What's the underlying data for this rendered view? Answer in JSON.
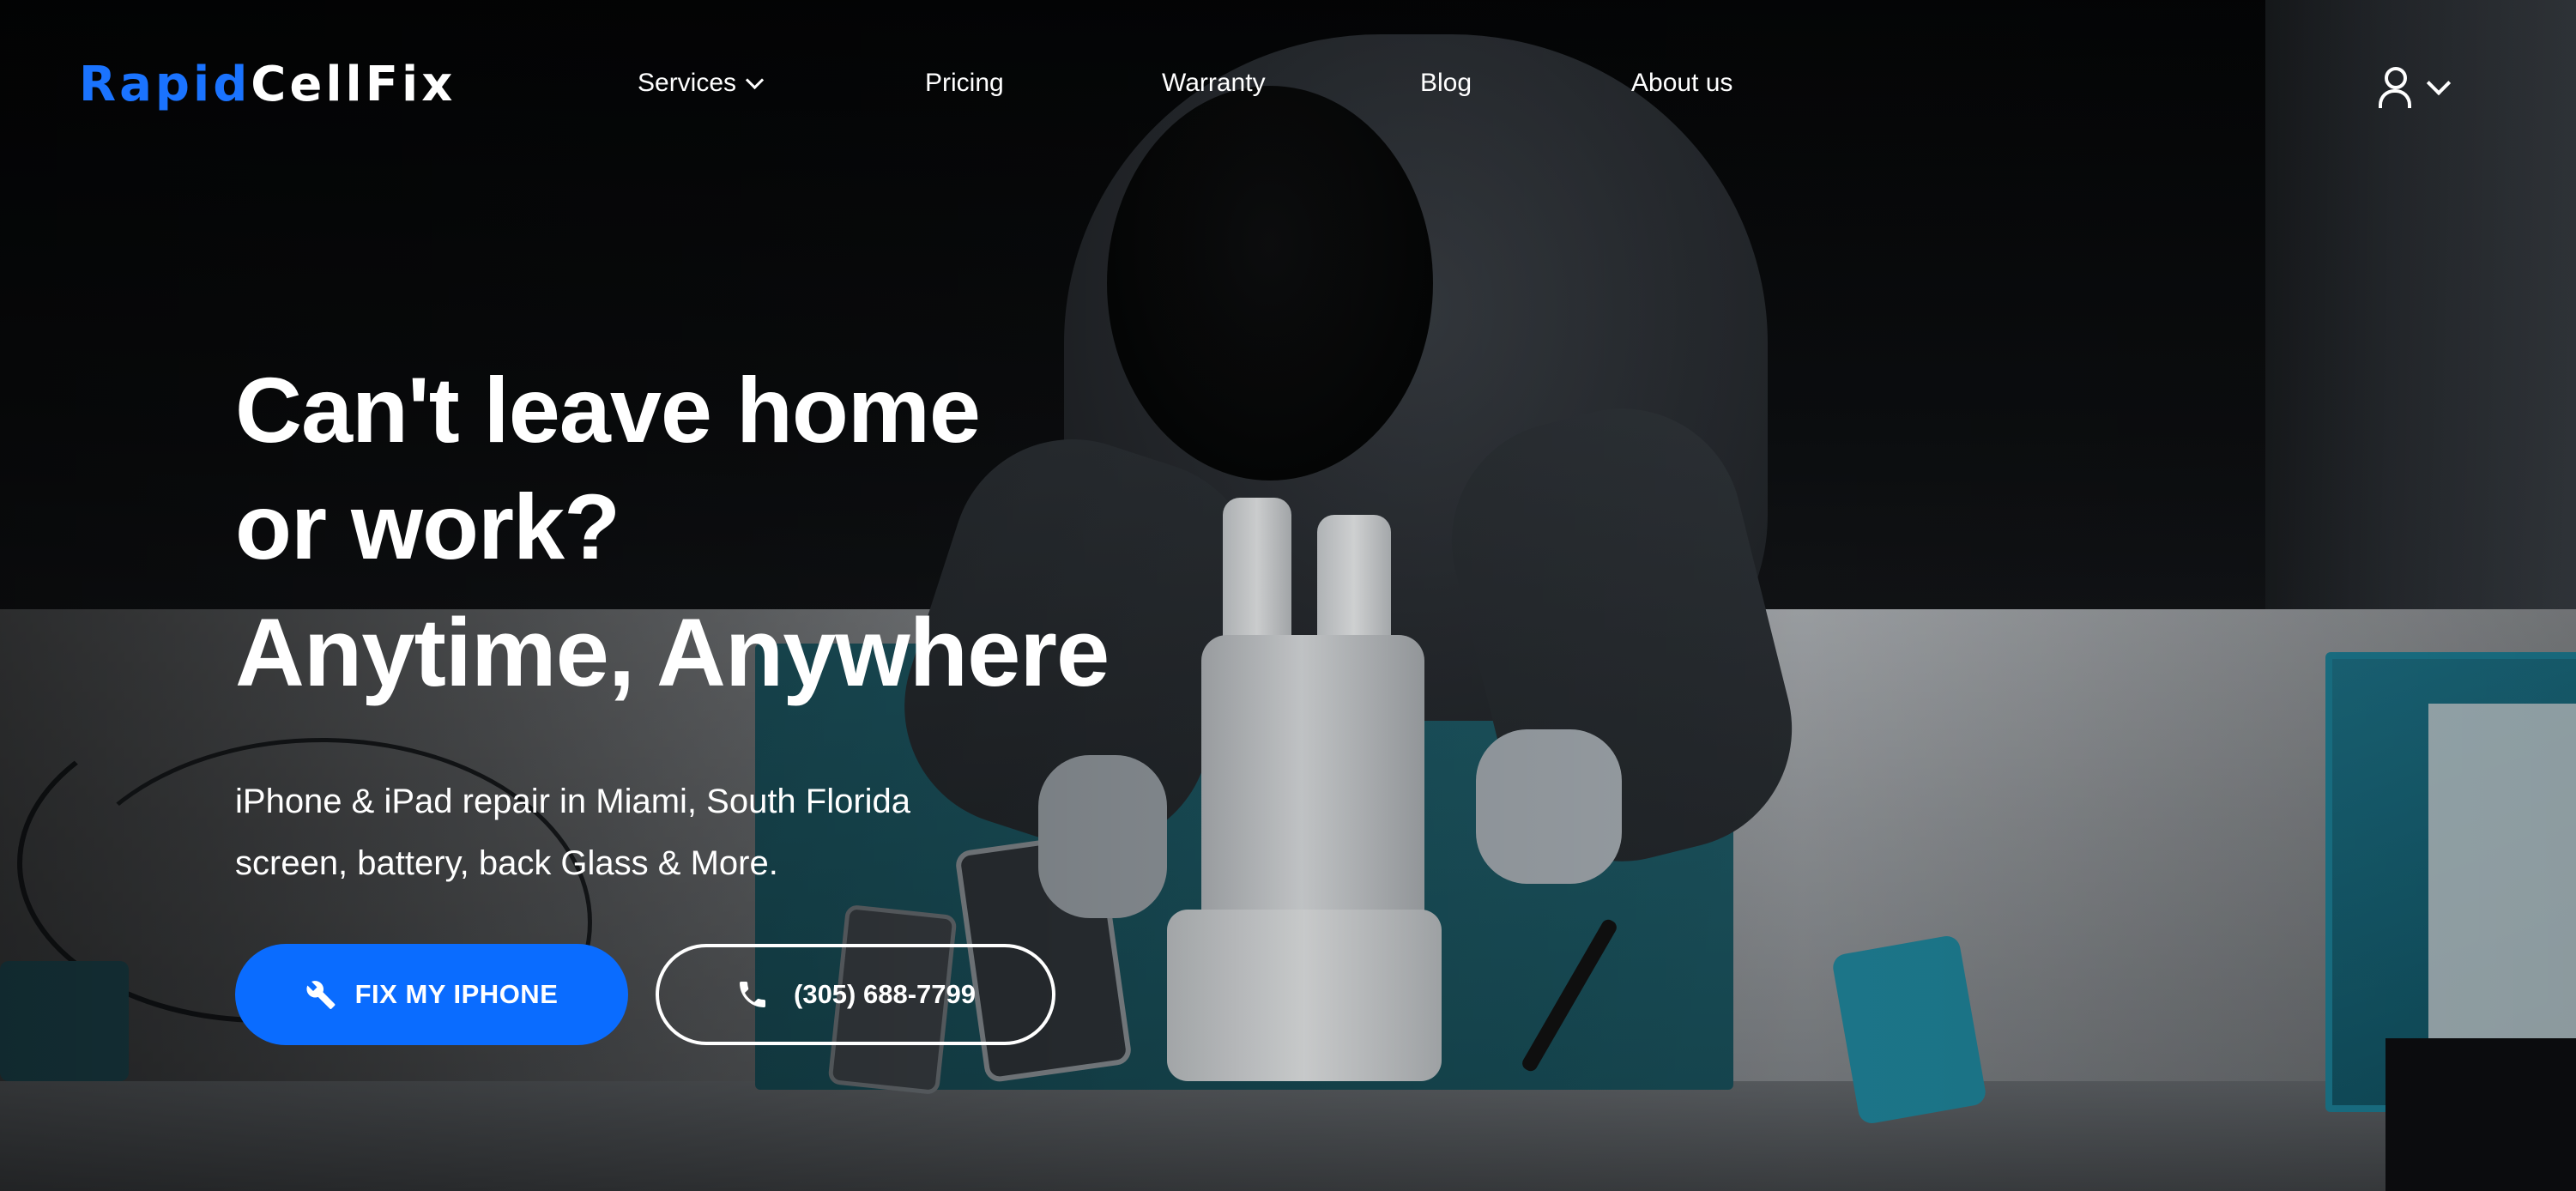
{
  "brand": {
    "part1": "Rapid",
    "part2": "CellFix",
    "accent_color": "#1a73ff"
  },
  "nav": {
    "items": [
      {
        "label": "Services",
        "has_dropdown": true,
        "icon": "chevron-down-icon"
      },
      {
        "label": "Pricing",
        "has_dropdown": false
      },
      {
        "label": "Warranty",
        "has_dropdown": false
      },
      {
        "label": "Blog",
        "has_dropdown": false
      },
      {
        "label": "About us",
        "has_dropdown": false
      }
    ],
    "user_menu": {
      "icon": "user-icon",
      "dropdown_icon": "chevron-down-icon"
    }
  },
  "hero": {
    "headline_line1": "Can't leave home",
    "headline_line2": "or work?",
    "headline_line3": "Anytime, Anywhere",
    "subtext_line1": "iPhone & iPad repair in Miami, South Florida",
    "subtext_line2": "screen, battery, back Glass & More.",
    "primary_cta": {
      "label": "FIX MY IPHONE",
      "icon": "wrench-icon",
      "color": "#0a6cff"
    },
    "secondary_cta": {
      "label": "(305) 688-7799",
      "icon": "phone-icon"
    }
  }
}
